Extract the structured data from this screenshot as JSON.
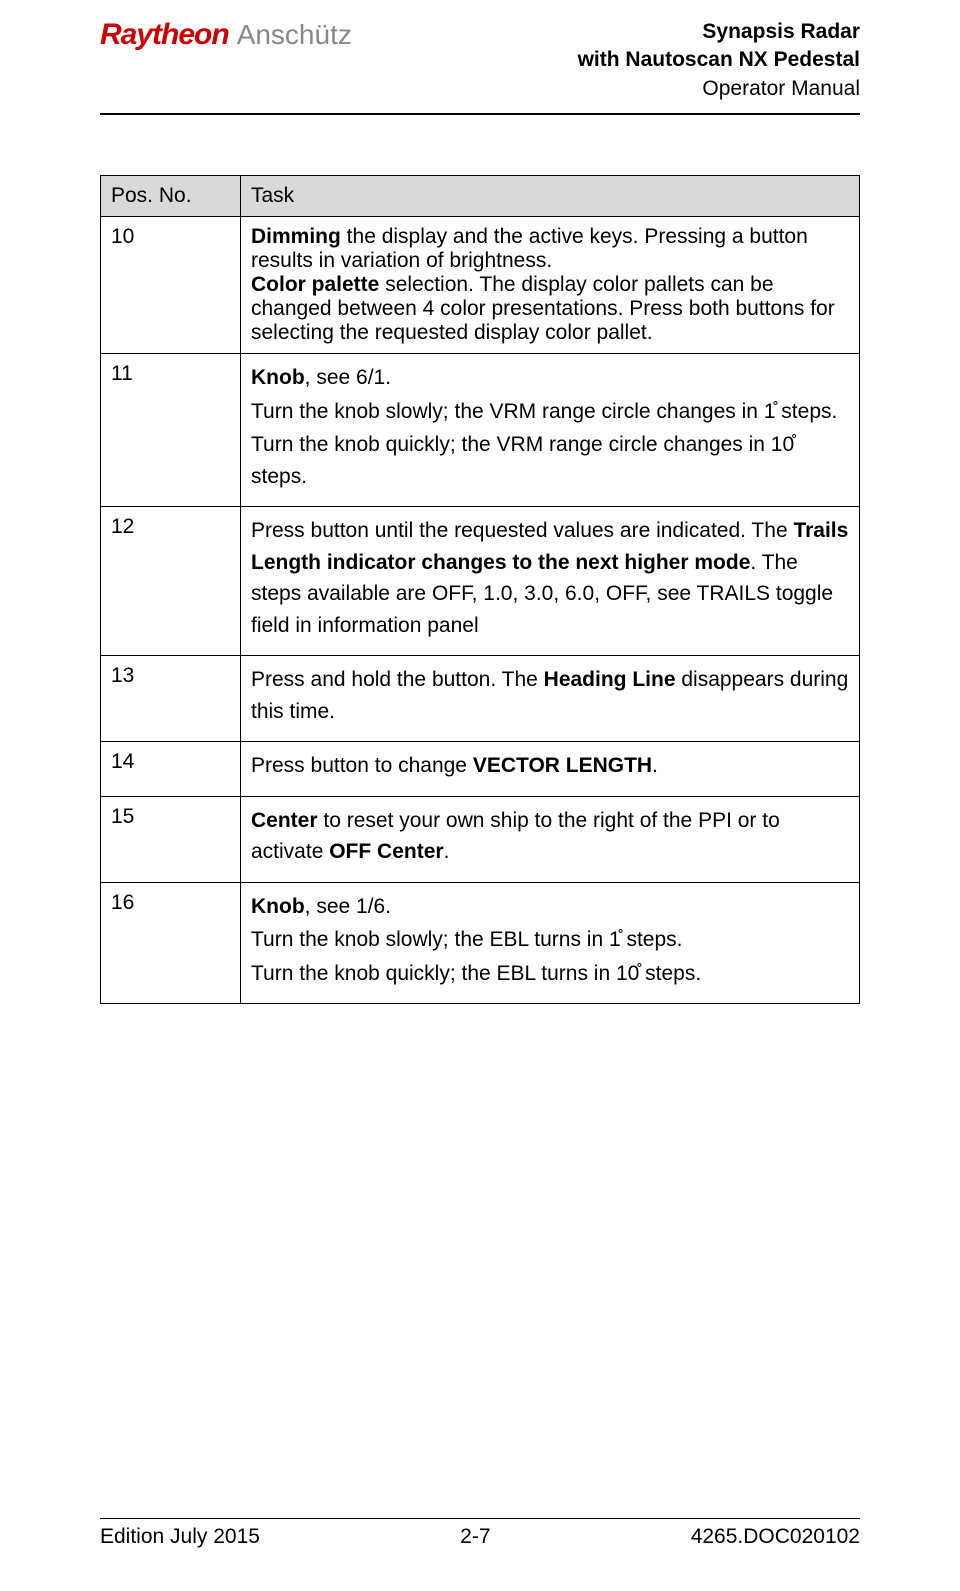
{
  "header": {
    "logo_brand": "Raytheon",
    "logo_sub": "Anschütz",
    "title_line1": "Synapsis Radar",
    "title_line2": "with Nautoscan NX Pedestal",
    "title_line3": "Operator Manual"
  },
  "table": {
    "headers": {
      "pos": "Pos. No.",
      "task": "Task"
    },
    "rows": [
      {
        "pos": "10",
        "task_html": "<b>Dimming</b> the display and the active keys. Pressing a button results in variation of brightness.<br><b>Color palette</b> selection. The display color pallets can be changed between 4 color presentations. Press both buttons for selecting the requested display color pallet."
      },
      {
        "pos": "11",
        "task_html": "<p><b>Knob</b>, see 6/1.</p><p>Turn the knob slowly; the VRM range circle changes in 1̊ steps.</p><p>Turn the knob quickly; the VRM range circle changes in 10̊ steps.</p>"
      },
      {
        "pos": "12",
        "task_html": "<p>Press button until the requested values are indicated. The <b>Trails Length indicator changes to the next higher mode</b>. The steps available are OFF, 1.0, 3.0, 6.0, OFF, see TRAILS toggle field in information panel</p>"
      },
      {
        "pos": "13",
        "task_html": "<p>Press and hold the button. The <b>Heading Line</b> disappears during this time.</p>"
      },
      {
        "pos": "14",
        "task_html": "<p>Press button to change <b>VECTOR LENGTH</b>.</p>"
      },
      {
        "pos": "15",
        "task_html": "<p><b>Center</b> to reset your own ship to the right of the PPI or to activate <b>OFF Center</b>.</p>"
      },
      {
        "pos": "16",
        "task_html": "<p><b>Knob</b>, see 1/6.</p><p>Turn the knob slowly; the EBL turns in 1̊ steps.</p><p>Turn the knob quickly; the EBL turns in 10̊ steps.</p>"
      }
    ]
  },
  "footer": {
    "left": "Edition July 2015",
    "center": "2-7",
    "right": "4265.DOC020102"
  }
}
